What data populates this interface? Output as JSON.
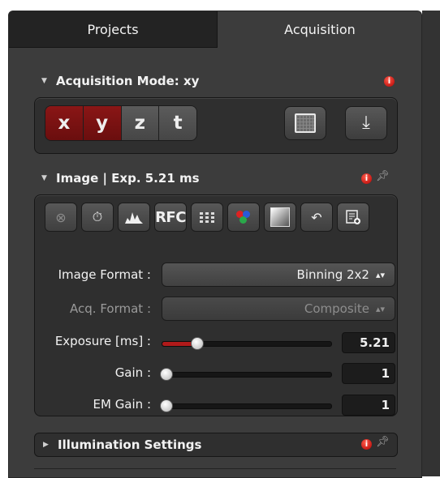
{
  "tabs": [
    {
      "label": "Projects",
      "active": false
    },
    {
      "label": "Acquisition",
      "active": true
    }
  ],
  "acquisition_mode": {
    "title": "Acquisition Mode: xy",
    "info_icon": "info-icon",
    "axes": [
      {
        "label": "x",
        "selected": true
      },
      {
        "label": "y",
        "selected": true
      },
      {
        "label": "z",
        "selected": false
      },
      {
        "label": "t",
        "selected": false
      }
    ],
    "buttons": [
      "grid-icon",
      "download-icon"
    ]
  },
  "image": {
    "title": "Image | Exp. 5.21 ms",
    "toolbar": [
      {
        "icon": "no-entry-icon"
      },
      {
        "icon": "timer-icon"
      },
      {
        "icon": "histogram-icon"
      },
      {
        "icon": "rfc-icon",
        "label": "RFC"
      },
      {
        "icon": "grid-icon"
      },
      {
        "icon": "color-channels-icon"
      },
      {
        "icon": "gradient-icon"
      },
      {
        "icon": "undo-icon"
      },
      {
        "icon": "list-add-icon"
      }
    ],
    "image_format": {
      "label": "Image Format :",
      "value": "Binning 2x2"
    },
    "acq_format": {
      "label": "Acq. Format :",
      "value": "Composite",
      "enabled": false
    },
    "exposure": {
      "label": "Exposure [ms] :",
      "value": "5.21",
      "slider_fraction": 0.2
    },
    "gain": {
      "label": "Gain :",
      "value": "1",
      "slider_fraction": 0
    },
    "em_gain": {
      "label": "EM Gain :",
      "value": "1",
      "slider_fraction": 0
    }
  },
  "illumination": {
    "title": "Illumination Settings"
  },
  "colors": {
    "accent": "#8a1616",
    "panel": "#2f2f2f",
    "background": "#3c3c3c"
  }
}
